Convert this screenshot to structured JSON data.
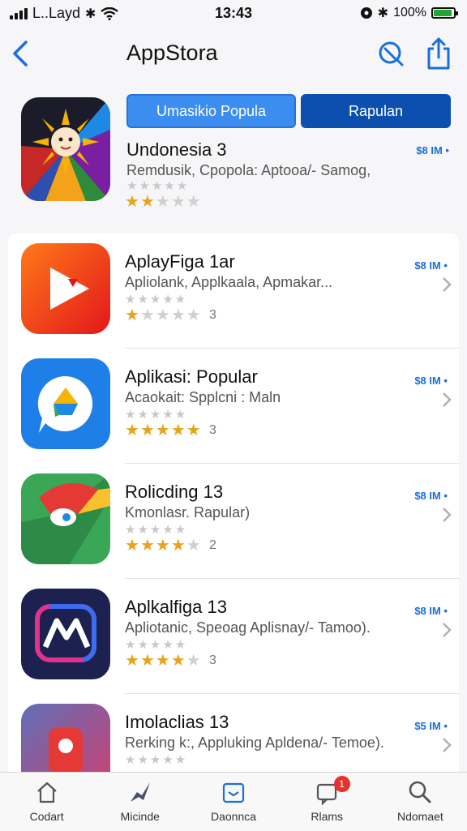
{
  "status_bar": {
    "carrier": "L..Layd",
    "time": "13:43",
    "battery_text": "100%"
  },
  "nav": {
    "title": "AppStora"
  },
  "featured": {
    "primary_button": "Umasikio Popula",
    "secondary_button": "Rapulan",
    "app_name": "Undonesia 3",
    "subtitle": "Remdusik, Cpopola: Aptooa/- Samog,",
    "price": "$8 IM •",
    "rating": 2
  },
  "apps": [
    {
      "name": "AplayFiga 1ar",
      "subtitle": "Apliolank, Applkaala, Apmakar...",
      "price": "$8 IM •",
      "rating": 1,
      "count": "3"
    },
    {
      "name": "Aplikasi: Popular",
      "subtitle": "Acaokait: Spplcni : Maln",
      "price": "$8 IM •",
      "rating": 5,
      "count": "3"
    },
    {
      "name": "Rolicding 13",
      "subtitle": "Kmonlasr. Rapular)",
      "price": "$8 IM •",
      "rating": 4,
      "count": "2"
    },
    {
      "name": "Aplkalfiga 13",
      "subtitle": "Apliotanic, Speoag Aplisnay/- Tamoo).",
      "price": "$8 IM •",
      "rating": 4,
      "count": "3"
    },
    {
      "name": "Imolaclias 13",
      "subtitle": "Rerking k:, Appluking Apldena/- Temoe).",
      "price": "$5 IM •",
      "rating": 0,
      "count": ""
    }
  ],
  "tabs": [
    {
      "label": "Codart",
      "icon": "home-icon"
    },
    {
      "label": "Micinde",
      "icon": "rocket-icon"
    },
    {
      "label": "Daonnca",
      "icon": "games-icon"
    },
    {
      "label": "Rlams",
      "icon": "updates-icon",
      "badge": "1"
    },
    {
      "label": "Ndomaet",
      "icon": "search-icon"
    }
  ],
  "colors": {
    "accent": "#1a6fd9",
    "star": "#e8a419",
    "button_primary": "#3b8df0",
    "button_dark": "#0d4fae",
    "badge": "#e5322d"
  }
}
